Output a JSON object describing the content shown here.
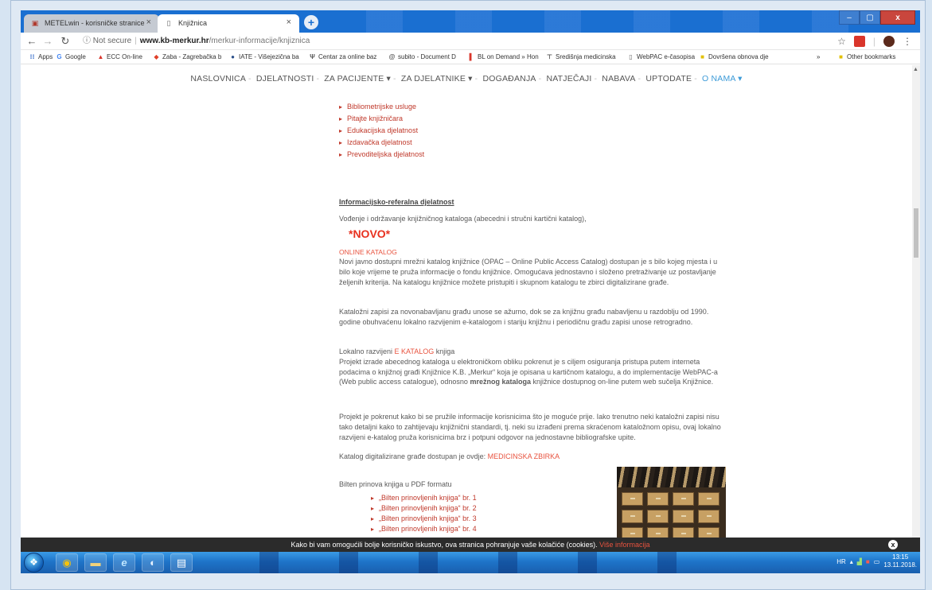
{
  "browser": {
    "tabs": [
      {
        "label": "METELwin - korisničke stranice",
        "favicon": "metel-icon"
      },
      {
        "label": "Knjižnica",
        "favicon": "page-icon"
      }
    ],
    "window_controls": {
      "minimize": "–",
      "maximize": "▢",
      "close": "x"
    },
    "address": {
      "insecure_label": "Not secure",
      "host": "www.kb-merkur.hr",
      "path": "/merkur-informacije/knjiznica"
    },
    "bookmarks": [
      {
        "label": "Apps",
        "icon": "apps-icon"
      },
      {
        "label": "Google",
        "icon": "google-icon"
      },
      {
        "label": "ECC On-line",
        "icon": "ecc-icon"
      },
      {
        "label": "Zaba - Zagrebačka b",
        "icon": "zaba-icon"
      },
      {
        "label": "IATE - Višejezična ba",
        "icon": "iate-icon"
      },
      {
        "label": "Centar za online baz",
        "icon": "centar-icon"
      },
      {
        "label": "subito - Document D",
        "icon": "subito-icon"
      },
      {
        "label": "BL on Demand » Hon",
        "icon": "bl-icon"
      },
      {
        "label": "Središnja medicinska",
        "icon": "smk-icon"
      },
      {
        "label": "WebPAC e-časopisa",
        "icon": "page-icon"
      },
      {
        "label": "Dovršena obnova dje",
        "icon": "folder-icon"
      }
    ],
    "more_bookmarks": "»",
    "other_bookmarks": "Other bookmarks"
  },
  "page": {
    "nav": [
      {
        "label": "NASLOVNICA",
        "active": false
      },
      {
        "label": "DJELATNOSTI",
        "active": false
      },
      {
        "label": "ZA PACIJENTE ▾",
        "active": false
      },
      {
        "label": "ZA DJELATNIKE ▾",
        "active": false
      },
      {
        "label": "DOGAĐANJA",
        "active": false
      },
      {
        "label": "NATJEČAJI",
        "active": false
      },
      {
        "label": "NABAVA",
        "active": false
      },
      {
        "label": "UPTODATE",
        "active": false
      },
      {
        "label": "O NAMA ▾",
        "active": true
      }
    ],
    "side_links": [
      "Bibliometrijske usluge",
      "Pitajte knjižničara",
      "Edukacijska djelatnost",
      "Izdavačka djelatnost",
      "Prevoditeljska djelatnost"
    ],
    "section_title": "Informacijsko-referalna djelatnost",
    "vodenje": "Vođenje i održavanje knjižničnog kataloga (abecedni i stručni kartični katalog),",
    "novo": "*NOVO*",
    "online_katalog": "ONLINE KATALOG",
    "p1": "Novi javno dostupni mrežni katalog knjižnice (OPAC – Online Public Access Catalog) dostupan je s bilo kojeg mjesta i u bilo koje vrijeme te pruža informacije o fondu knjižnice. Omogućava jednostavno i složeno pretraživanje uz postavljanje željenih kriterija. Na katalogu knjižnice možete pristupiti i skupnom katalogu te zbirci digitalizirane građe.",
    "p2": "Kataložni zapisi za novonabavljanu građu unose se ažurno, dok se za knjižnu građu nabavljenu u razdoblju od 1990. godine obuhvaćenu lokalno razvijenim e-katalogom i stariju knjižnu i periodičnu građu zapisi unose retrogradno.",
    "p3_pre": "Lokalno razvijeni ",
    "p3_link": "E KATALOG",
    "p3_post": " knjiga",
    "p3_body_a": "Projekt izrade abecednog kataloga u elektroničkom obliku pokrenut je s ciljem osiguranja pristupa putem interneta podacima o knjižnoj građi Knjižnice K.B. „Merkur“ koja je opisana u kartičnom katalogu, a do implementacije WebPAC-a (Web public access catalogue), odnosno ",
    "p3_bold": "mrežnog kataloga",
    "p3_body_b": " knjižnice dostupnog on-line putem web sučelja Knjižnice.",
    "p4": "Projekt je pokrenut kako bi se pružile informacije korisnicima što je moguće prije. Iako trenutno neki kataložni zapisi nisu tako detaljni kako to zahtijevaju knjižnični standardi, tj. neki su izrađeni prema skraćenom kataložnom opisu, ovaj lokalno razvijeni e-katalog pruža korisnicima brz i potpuni odgovor na jednostavne bibliografske upite.",
    "p5_pre": "Katalog digitalizirane građe dostupan je ovdje: ",
    "p5_link": "MEDICINSKA ZBIRKA",
    "p6": "Bilten prinova knjiga u PDF formatu",
    "bilten": [
      "„Bilten prinovljenih knjiga“ br. 1",
      "„Bilten prinovljenih knjiga“ br. 2",
      "„Bilten prinovljenih knjiga“ br. 3",
      "„Bilten prinovljenih knjiga“ br. 4"
    ]
  },
  "cookie": {
    "text": "Kako bi vam omogućili bolje korisničko iskustvo, ova stranica pohranjuje vaše kolačiće (cookies).",
    "more": "Više informacija",
    "close": "x"
  },
  "taskbar": {
    "lang": "HR",
    "time": "13:15",
    "date": "13.11.2018."
  }
}
